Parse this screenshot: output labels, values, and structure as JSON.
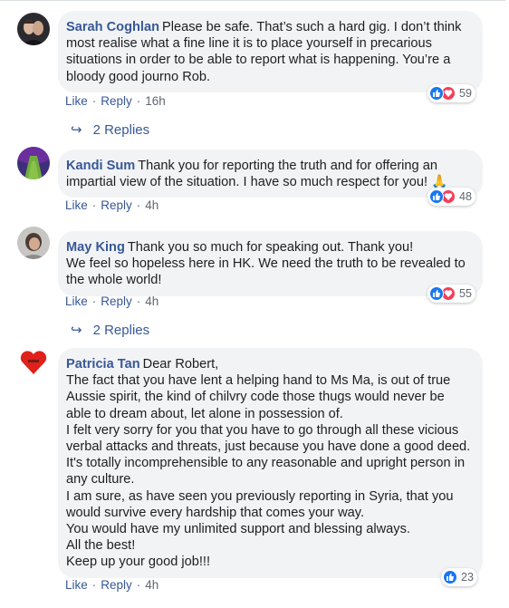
{
  "comments": [
    {
      "author": "Sarah Coghlan",
      "text": "Please be safe. That’s such a hard gig. I don’t think most realise what a fine line it is to place yourself in precarious situations in order to be able to report what is happening. You’re a bloody good journo Rob.",
      "reaction_count": "59",
      "reactions": [
        "like",
        "love"
      ],
      "like_label": "Like",
      "reply_label": "Reply",
      "time": "16h",
      "replies_label": "2 Replies"
    },
    {
      "author": "Kandi Sum",
      "text": "Thank you for reporting the truth and for offering an impartial view of the situation. I have so much respect for you! 🙏",
      "reaction_count": "48",
      "reactions": [
        "like",
        "love"
      ],
      "like_label": "Like",
      "reply_label": "Reply",
      "time": "4h"
    },
    {
      "author": "May King",
      "lines": [
        "Thank you so much for speaking out. Thank you!",
        "We feel so hopeless here in HK. We need the truth to be revealed to the whole world!"
      ],
      "reaction_count": "55",
      "reactions": [
        "like",
        "love"
      ],
      "like_label": "Like",
      "reply_label": "Reply",
      "time": "4h",
      "replies_label": "2 Replies"
    },
    {
      "author": "Patricia Tan",
      "lines": [
        "Dear Robert,",
        "The fact that you have lent a helping hand to Ms Ma, is out of true Aussie spirit, the kind of chilvry code those thugs would never be able to dream about, let alone in possession of.",
        "I felt very sorry for you that you have to go through all these vicious verbal attacks and threats, just because you have done a good deed. It's totally incomprehensible to any reasonable and upright person in any culture.",
        "I am sure, as have seen you previously reporting in Syria,   that you would survive every hardship that comes your way.",
        "You would have my unlimited support and blessing always.",
        "All the best!",
        "Keep up your good job!!!"
      ],
      "reaction_count": "23",
      "reactions": [
        "like"
      ],
      "like_label": "Like",
      "reply_label": "Reply",
      "time": "4h"
    }
  ],
  "colors": {
    "author": "#385898",
    "bubble": "#f2f3f5",
    "like": "#1877f2",
    "love": "#f33e58",
    "meta": "#606770"
  }
}
